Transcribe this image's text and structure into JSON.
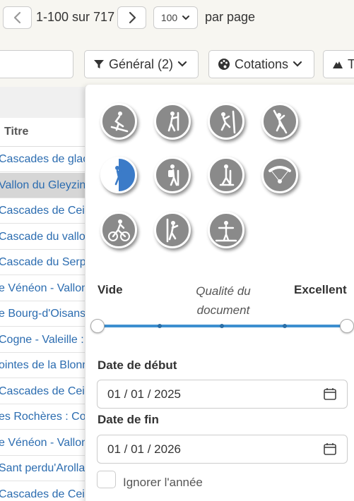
{
  "pagination": {
    "range_label": "1-100 sur 717",
    "per_page_value": "100",
    "per_page_label": "par page"
  },
  "filters": {
    "general_label": "Général (2)",
    "cotations_label": "Cotations",
    "third_label": "T"
  },
  "table": {
    "column_title": "Titre",
    "rows": [
      "Cascades de glace",
      "Vallon du Gleyzin :",
      "Cascades de Ceilla",
      "Cascade du vallon",
      "Cascade du Serpol",
      "e Vénéon - Vallon",
      "e Bourg-d'Oisans",
      "Cogne - Valeille : L",
      "ointes de la Blonn",
      "Cascades de Ceilla",
      "es Rochères : Com",
      "e Vénéon - Vallon",
      "Sant perdu'Arolla :",
      "Cascades de Ceilla"
    ],
    "selected_row_index": 1
  },
  "activities": [
    {
      "name": "skitouring",
      "selected": false
    },
    {
      "name": "snow_ice_mixed",
      "selected": false
    },
    {
      "name": "mountain_climbing",
      "selected": false
    },
    {
      "name": "rock_climbing",
      "selected": false
    },
    {
      "name": "ice_climbing",
      "selected": true
    },
    {
      "name": "hiking",
      "selected": false
    },
    {
      "name": "snowshoeing",
      "selected": false
    },
    {
      "name": "paragliding",
      "selected": false
    },
    {
      "name": "mountain_biking",
      "selected": false
    },
    {
      "name": "via_ferrata",
      "selected": false
    },
    {
      "name": "slacklining",
      "selected": false
    }
  ],
  "quality": {
    "min_label": "Vide",
    "mid_label": "Qualité du document",
    "max_label": "Excellent"
  },
  "dates": {
    "start_label": "Date de début",
    "start_value": "01 / 01 / 2025",
    "end_label": "Date de fin",
    "end_value": "01 / 01 / 2026",
    "ignore_year_label": "Ignorer l'année",
    "ignore_year_checked": false
  },
  "colors": {
    "accent": "#3b7bc8",
    "link": "#2b6cb0",
    "icon_gray": "#8a8a8a"
  }
}
